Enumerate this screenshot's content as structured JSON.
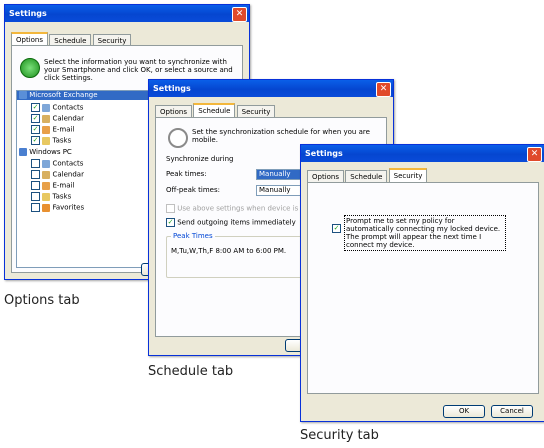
{
  "options_window": {
    "title": "Settings",
    "tabs": [
      "Options",
      "Schedule",
      "Security"
    ],
    "intro": "Select the information you want to synchronize with your Smartphone and click OK, or select a source and click Settings.",
    "exchange": {
      "label": "Microsoft Exchange",
      "items": [
        "Contacts",
        "Calendar",
        "E-mail",
        "Tasks"
      ]
    },
    "windows_pc": {
      "label": "Windows PC",
      "items": [
        "Contacts",
        "Calendar",
        "E-mail",
        "Tasks",
        "Favorites"
      ]
    },
    "button_partial": "O"
  },
  "schedule_window": {
    "title": "Settings",
    "tabs": [
      "Options",
      "Schedule",
      "Security"
    ],
    "intro": "Set the synchronization schedule for when you are mobile.",
    "sync_during": "Synchronize during",
    "peak_label": "Peak times:",
    "peak_value": "Manually",
    "offpeak_label": "Off-peak times:",
    "offpeak_value": "Manually",
    "roaming_text": "Use above settings when device is roa",
    "send_outgoing": "Send outgoing items immediately",
    "peak_group": "Peak Times",
    "peak_times": "M,Tu,W,Th,F 8:00 AM to 6:00 PM."
  },
  "security_window": {
    "title": "Settings",
    "tabs": [
      "Options",
      "Schedule",
      "Security"
    ],
    "policy_text": "Prompt me to set my policy for automatically connecting my locked device. The prompt will appear the next time I connect my device.",
    "ok": "OK",
    "cancel": "Cancel"
  },
  "captions": {
    "options": "Options tab",
    "schedule": "Schedule tab",
    "security": "Security tab"
  }
}
